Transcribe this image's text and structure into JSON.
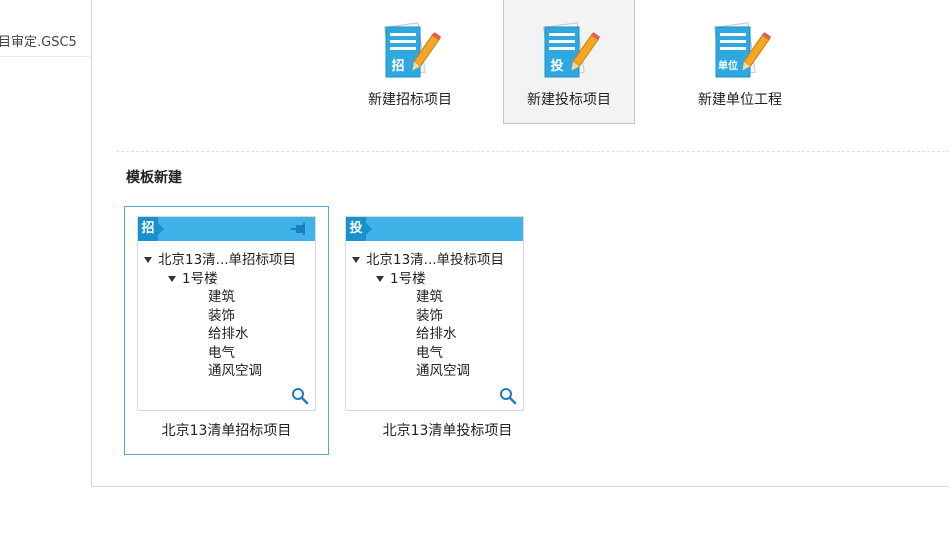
{
  "left_list": {
    "item_text": "目审定.GSC5"
  },
  "new_options": [
    {
      "label": "新建招标项目",
      "badge": "招",
      "icon": "document-pencil-icon",
      "selected": false
    },
    {
      "label": "新建投标项目",
      "badge": "投",
      "icon": "document-pencil-icon",
      "selected": true
    },
    {
      "label": "新建单位工程",
      "badge": "单位",
      "icon": "document-pencil-icon",
      "selected": false
    }
  ],
  "template_section": {
    "title": "模板新建",
    "cards": [
      {
        "tag": "招",
        "root": "北京13清...单招标项目",
        "building": "1号楼",
        "items": [
          "建筑",
          "装饰",
          "给排水",
          "电气",
          "通风空调"
        ],
        "name": "北京13清单招标项目",
        "selected": true,
        "pinned": true
      },
      {
        "tag": "投",
        "root": "北京13清...单投标项目",
        "building": "1号楼",
        "items": [
          "建筑",
          "装饰",
          "给排水",
          "电气",
          "通风空调"
        ],
        "name": "北京13清单投标项目",
        "selected": false,
        "pinned": false
      }
    ]
  },
  "colors": {
    "accent_blue": "#3fb3e8",
    "tag_blue": "#1a91cf",
    "selected_border": "#58a6d6"
  }
}
